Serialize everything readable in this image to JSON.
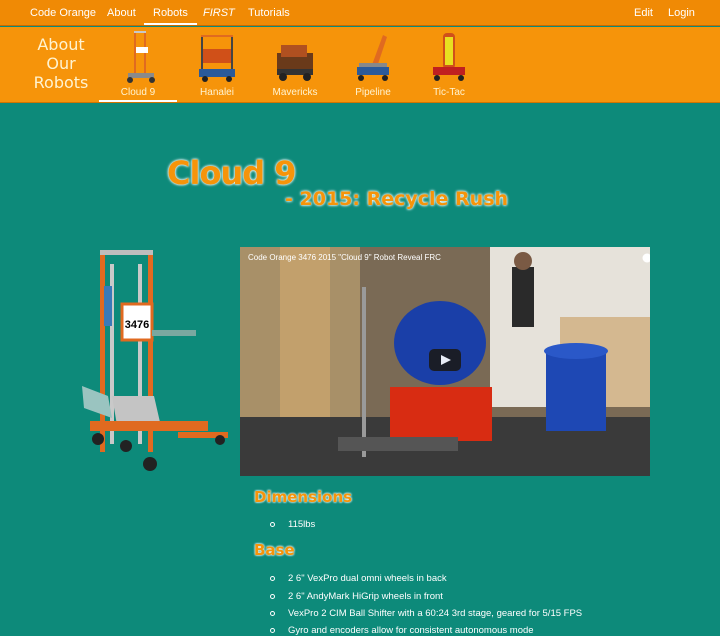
{
  "topnav": {
    "brand": "Code Orange",
    "items": [
      "About",
      "Robots",
      "FIRST",
      "Tutorials"
    ],
    "right": [
      "Edit",
      "Login"
    ]
  },
  "robotbar": {
    "heading": [
      "About",
      "Our",
      "Robots"
    ],
    "robots": [
      "Cloud 9",
      "Hanalei",
      "Mavericks",
      "Pipeline",
      "Tic-Tac"
    ]
  },
  "page": {
    "title": "Cloud 9",
    "subtitle": "- 2015: Recycle Rush",
    "robot_number": "3476"
  },
  "video": {
    "title": "Code Orange 3476 2015 \"Cloud 9\" Robot Reveal FRC"
  },
  "sections": {
    "dimensions": {
      "heading": "Dimensions",
      "items": [
        "115lbs"
      ]
    },
    "base": {
      "heading": "Base",
      "items": [
        "2 6\" VexPro dual omni wheels in back",
        "2 6\" AndyMark HiGrip wheels in front",
        "VexPro 2 CIM Ball Shifter with a 60:24 3rd stage, geared for 5/15 FPS",
        "Gyro and encoders allow for consistent autonomous mode"
      ]
    }
  },
  "colors": {
    "accent": "#f6940a",
    "background": "#0d8a7a"
  }
}
